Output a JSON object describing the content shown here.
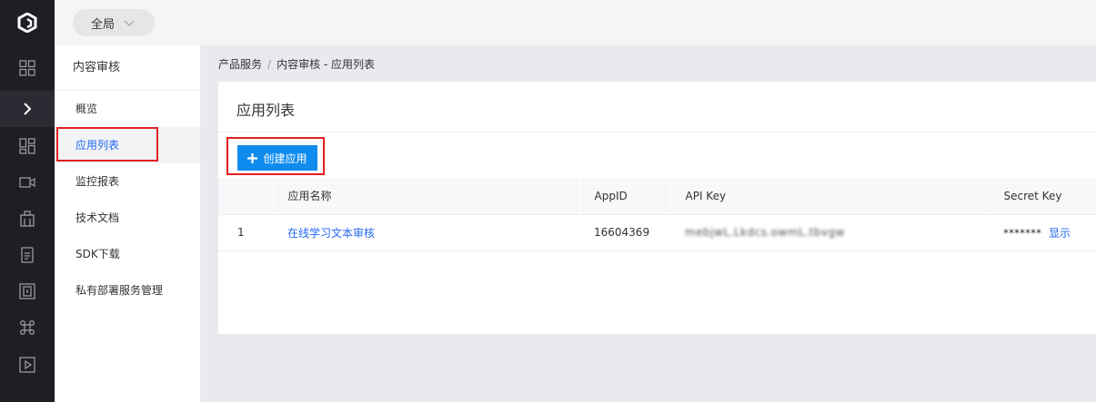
{
  "rail": {
    "icons": [
      "logo-icon",
      "grid-icon",
      "chevron-right-icon",
      "dashboard-icon",
      "video-icon",
      "building-icon",
      "document-icon",
      "face-scan-icon",
      "command-icon",
      "play-icon"
    ]
  },
  "topbar": {
    "scope_label": "全局"
  },
  "subnav": {
    "title": "内容审核",
    "items": [
      {
        "label": "概览"
      },
      {
        "label": "应用列表"
      },
      {
        "label": "监控报表"
      },
      {
        "label": "技术文档"
      },
      {
        "label": "SDK下载"
      },
      {
        "label": "私有部署服务管理"
      }
    ]
  },
  "breadcrumb": {
    "root": "产品服务",
    "separator": "/",
    "current": "内容审核 - 应用列表"
  },
  "card": {
    "title": "应用列表",
    "create_label": "创建应用",
    "columns": [
      "",
      "应用名称",
      "AppID",
      "API Key",
      "Secret Key"
    ],
    "rows": [
      {
        "index": "1",
        "name": "在线学习文本审核",
        "app_id": "16604369",
        "api_key": "mebjwL.Lkdcs.owmL.tbvgw",
        "secret_key": "*******",
        "show_label": "显示"
      }
    ]
  },
  "colors": {
    "primary_button": "#108cee",
    "link": "#2468f2",
    "highlight_box": "#e02020",
    "rail_bg": "#1e1e24"
  }
}
